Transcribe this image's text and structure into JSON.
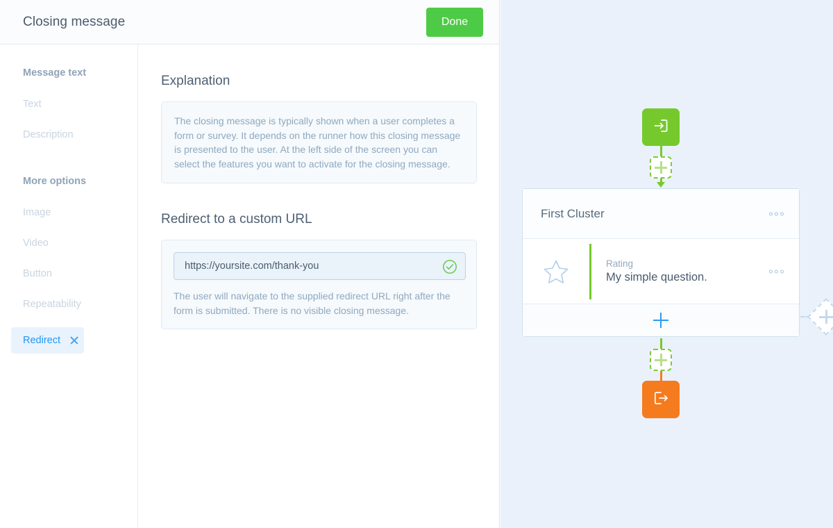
{
  "editor": {
    "title": "Closing message",
    "done_label": "Done",
    "sidebar": {
      "groups": [
        {
          "title": "Message text",
          "items": [
            {
              "label": "Text"
            },
            {
              "label": "Description"
            }
          ]
        },
        {
          "title": "More options",
          "items": [
            {
              "label": "Image"
            },
            {
              "label": "Video"
            },
            {
              "label": "Button"
            },
            {
              "label": "Repeatability"
            }
          ]
        }
      ],
      "active_item": {
        "label": "Redirect",
        "close_icon": "close-icon"
      }
    },
    "explanation": {
      "heading": "Explanation",
      "body": "The closing message is typically shown when a user completes a form or survey. It depends on the runner how this closing message is presented to the user. At the left side of the screen you can select the features you want to activate for the closing message."
    },
    "redirect": {
      "heading": "Redirect to a custom URL",
      "url_value": "https://yoursite.com/thank-you",
      "url_placeholder": "https://",
      "valid_icon": "check-circle-icon",
      "help": "The user will navigate to the supplied redirect URL right after the form is submitted. There is no visible closing message."
    }
  },
  "flow": {
    "entry_node": {
      "icon": "enter-arrow-icon",
      "color": "#76c92c"
    },
    "exit_node": {
      "icon": "exit-arrow-icon",
      "color": "#f57b1f"
    },
    "add_node_top": {
      "icon": "plus-icon"
    },
    "add_node_bottom": {
      "icon": "plus-icon"
    },
    "add_branch_right": {
      "icon": "plus-icon"
    },
    "cluster": {
      "name": "First Cluster",
      "menu_icon": "more-options-icon",
      "questions": [
        {
          "kind": "Rating",
          "title": "My simple question.",
          "icon": "star-icon",
          "menu_icon": "more-options-icon",
          "accent": "#76c92c"
        }
      ],
      "add_question_icon": "plus-icon"
    }
  }
}
